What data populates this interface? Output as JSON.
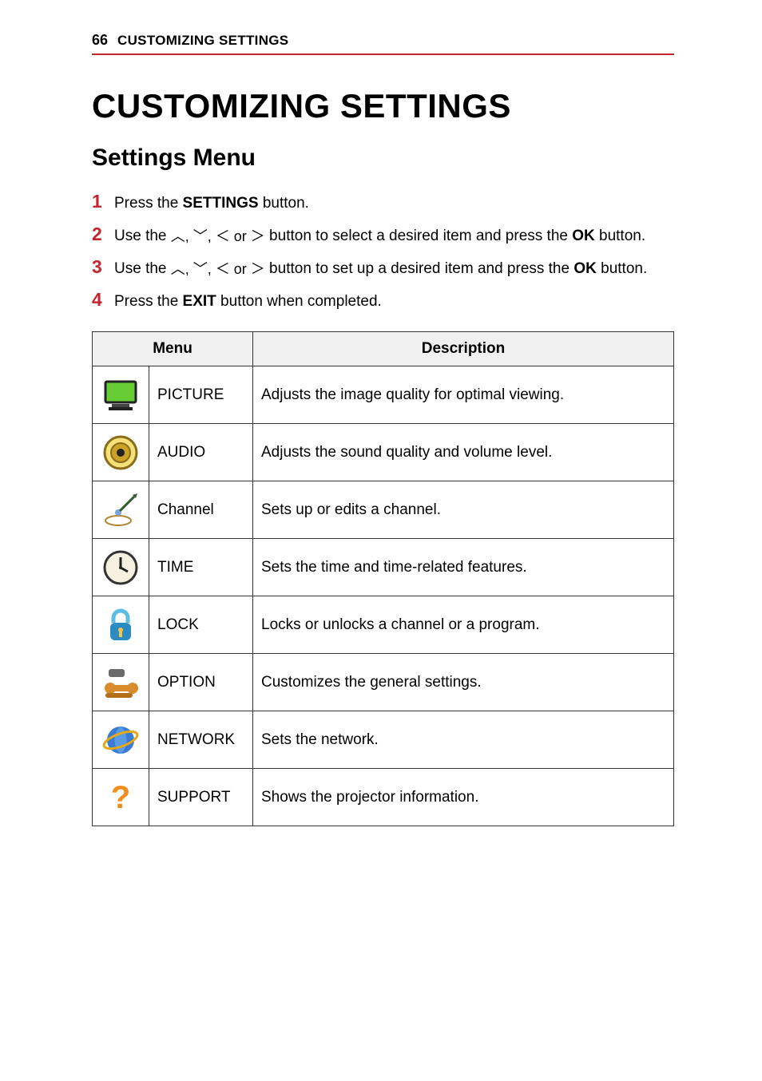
{
  "header": {
    "page_number": "66",
    "running_title": "CUSTOMIZING SETTINGS"
  },
  "main_title": "CUSTOMIZING SETTINGS",
  "section_title": "Settings Menu",
  "steps": [
    {
      "num": "1",
      "prefix": "Press the ",
      "bold": "SETTINGS",
      "suffix": " button."
    },
    {
      "num": "2",
      "prefix": "Use the ",
      "glyphs": "︿, ﹀, ＜ or ＞",
      "mid": " button to select a desired item and press the ",
      "bold": "OK",
      "suffix": " button."
    },
    {
      "num": "3",
      "prefix": "Use the ",
      "glyphs": "︿, ﹀, ＜ or ＞",
      "mid": " button to set up a desired item and press the ",
      "bold": "OK",
      "suffix": " button."
    },
    {
      "num": "4",
      "prefix": "Press the ",
      "bold": "EXIT",
      "suffix": " button when completed."
    }
  ],
  "table": {
    "head_menu": "Menu",
    "head_description": "Description",
    "rows": [
      {
        "icon": "picture",
        "label": "PICTURE",
        "desc": "Adjusts the image quality for optimal viewing."
      },
      {
        "icon": "audio",
        "label": "AUDIO",
        "desc": "Adjusts the sound quality and volume level."
      },
      {
        "icon": "channel",
        "label": "Channel",
        "desc": "Sets up or edits a channel."
      },
      {
        "icon": "time",
        "label": "TIME",
        "desc": "Sets the time and time-related features."
      },
      {
        "icon": "lock",
        "label": "LOCK",
        "desc": "Locks or unlocks a channel or a program."
      },
      {
        "icon": "option",
        "label": "OPTION",
        "desc": "Customizes the general settings."
      },
      {
        "icon": "network",
        "label": "NETWORK",
        "desc": "Sets the network."
      },
      {
        "icon": "support",
        "label": "SUPPORT",
        "desc": "Shows the projector information."
      }
    ]
  }
}
